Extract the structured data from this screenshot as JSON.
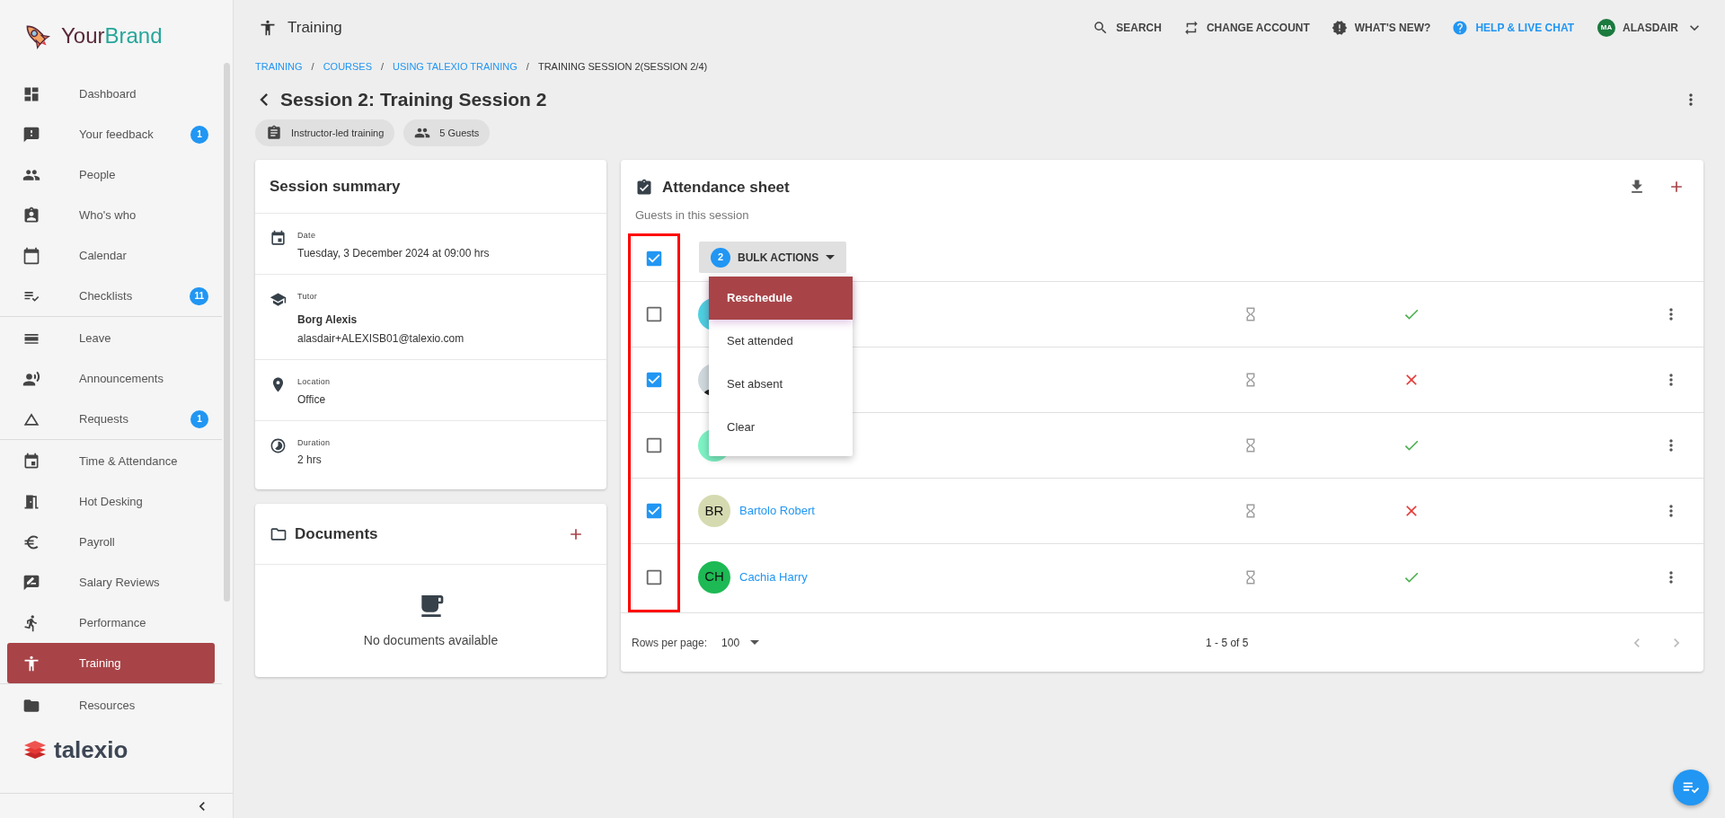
{
  "brand": {
    "parts": [
      "Your",
      "Brand"
    ]
  },
  "sidebar": {
    "groups": [
      [
        {
          "label": "Dashboard",
          "selected": false
        },
        {
          "label": "Your feedback",
          "selected": false,
          "badge": "1"
        },
        {
          "label": "People",
          "selected": false
        },
        {
          "label": "Who's who",
          "selected": false
        },
        {
          "label": "Calendar",
          "selected": false
        },
        {
          "label": "Checklists",
          "selected": false,
          "badge": "11"
        }
      ],
      [
        {
          "label": "Leave",
          "selected": false
        },
        {
          "label": "Announcements",
          "selected": false
        },
        {
          "label": "Requests",
          "selected": false,
          "badge": "1"
        }
      ],
      [
        {
          "label": "Time & Attendance",
          "selected": false
        },
        {
          "label": "Hot Desking",
          "selected": false
        },
        {
          "label": "Payroll",
          "selected": false
        },
        {
          "label": "Salary Reviews",
          "selected": false
        },
        {
          "label": "Performance",
          "selected": false
        },
        {
          "label": "Training",
          "selected": true
        }
      ],
      [
        {
          "label": "Resources",
          "selected": false
        }
      ]
    ],
    "footer_logo": "talexio"
  },
  "topbar": {
    "title": "Training",
    "actions": [
      {
        "label": "SEARCH",
        "kind": "plain"
      },
      {
        "label": "CHANGE ACCOUNT",
        "kind": "plain"
      },
      {
        "label": "WHAT'S NEW?",
        "kind": "plain"
      },
      {
        "label": "HELP & LIVE CHAT",
        "kind": "accent"
      }
    ],
    "user": {
      "initials": "MA",
      "name": "ALASDAIR"
    }
  },
  "breadcrumb": [
    {
      "label": "TRAINING",
      "link": true
    },
    {
      "separator": "/",
      "label": "COURSES",
      "link": true
    },
    {
      "separator": "/",
      "label": "USING TALEXIO TRAINING",
      "link": true
    },
    {
      "separator": "/",
      "label": "TRAINING SESSION 2(SESSION 2/4)",
      "link": false
    }
  ],
  "page": {
    "title": "Session 2: Training Session 2",
    "chips": [
      "Instructor-led training",
      "5 Guests"
    ]
  },
  "summary": {
    "title": "Session summary",
    "fields": [
      {
        "label": "Date",
        "lines": [
          "Tuesday, 3 December 2024 at 09:00 hrs"
        ]
      },
      {
        "label": "Tutor",
        "name": "Borg Alexis",
        "lines": [
          "alasdair+ALEXISB01@talexio.com"
        ]
      },
      {
        "label": "Location",
        "lines": [
          "Office"
        ]
      },
      {
        "label": "Duration",
        "lines": [
          "2 hrs"
        ]
      }
    ]
  },
  "documents": {
    "title": "Documents",
    "empty": "No documents available"
  },
  "attendance": {
    "title": "Attendance sheet",
    "subtitle": "Guests in this session",
    "all_checked": true,
    "bulk": {
      "count": "2",
      "label": "BULK ACTIONS"
    },
    "menu": [
      {
        "label": "Reschedule",
        "selected": true
      },
      {
        "label": "Set attended",
        "selected": false
      },
      {
        "label": "Set absent",
        "selected": false
      },
      {
        "label": "Clear",
        "selected": false
      }
    ],
    "rows": [
      {
        "checked": false,
        "photo": false,
        "color": "#4dd0e1",
        "attended": true
      },
      {
        "checked": true,
        "photo": true,
        "attended": false
      },
      {
        "checked": false,
        "photo": false,
        "color": "#7df2c4",
        "attended": true
      },
      {
        "checked": true,
        "photo": false,
        "color": "#d6dab0",
        "initials": "BR",
        "name": "Bartolo Robert",
        "attended": false
      },
      {
        "checked": false,
        "photo": false,
        "color": "#1db954",
        "initials": "CH",
        "name": "Cachia Harry",
        "attended": true
      }
    ],
    "footer": {
      "rows_label": "Rows per page:",
      "rows_value": "100",
      "range": "1 - 5 of 5"
    }
  }
}
